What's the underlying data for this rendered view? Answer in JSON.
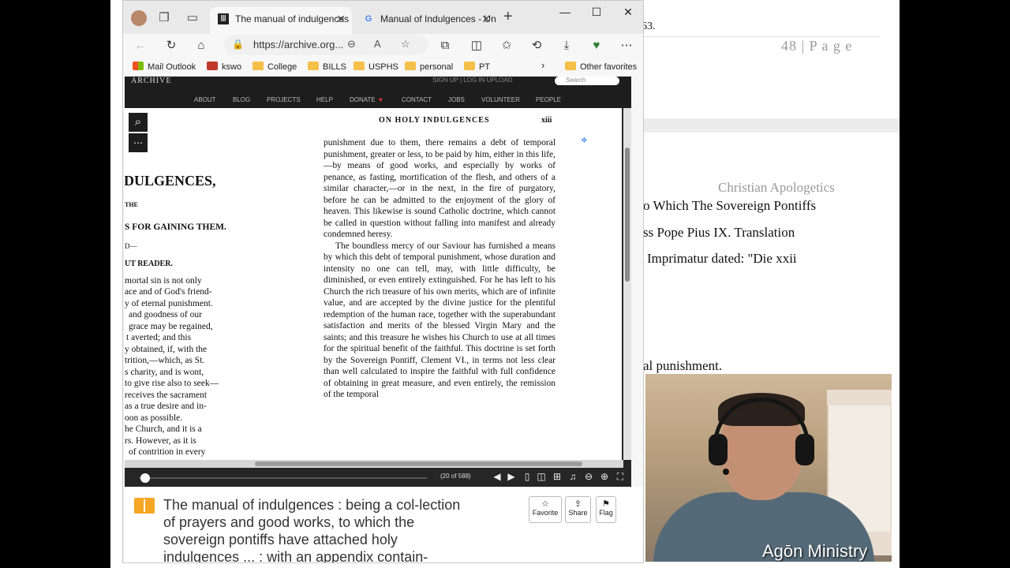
{
  "background_doc": {
    "top_fragment": "63.",
    "page_label": "48 | P a g e",
    "header_right": "Christian Apologetics",
    "lines": [
      "o Which The Sovereign Pontiffs",
      "ss Pope Pius IX. Translation",
      "Imprimatur dated: \"Die xxii",
      "al punishment."
    ]
  },
  "browser": {
    "tabs": [
      {
        "title": "The manual of indulgences",
        "active": true
      },
      {
        "title": "Manual of Indulgences - Un",
        "active": false
      }
    ],
    "address": "https://archive.org...",
    "bookmarks": [
      "Mail Outlook",
      "kswo",
      "College",
      "BILLS",
      "USPHS",
      "personal",
      "PT",
      "Other favorites"
    ]
  },
  "archive": {
    "logo": "ARCHIVE",
    "top_links": "SIGN UP | LOG IN    UPLOAD",
    "search_placeholder": "Search",
    "nav": [
      "ABOUT",
      "BLOG",
      "PROJECTS",
      "HELP",
      "DONATE",
      "CONTACT",
      "JOBS",
      "VOLUNTEER",
      "PEOPLE"
    ],
    "page_counter": "(20 of 588)",
    "book_title": "The manual of indulgences : being a col-lection of prayers and good works, to which the sovereign pontiffs have attached holy indulgences ... : with an appendix contain-",
    "actions": [
      "Favorite",
      "Share",
      "Flag"
    ]
  },
  "scan": {
    "left_lines": [
      "DULGENCES,",
      "THE",
      "S FOR GAINING THEM.",
      "D—",
      "UT READER.",
      "mortal sin is not only",
      "ace and of God's friend-",
      "y of eternal punishment.",
      "and goodness of our",
      "grace may be regained,",
      "t averted; and this",
      "y obtained, if, with the",
      "trition,—which, as St.",
      "s charity, and is wont,",
      "to give rise also to seek—",
      "receives the sacrament",
      "as a true desire and in-",
      "oon as possible.",
      "he Church, and it is a",
      "rs. However, as it is",
      "of contrition in every"
    ],
    "running_head": "ON HOLY INDULGENCES",
    "page_number": "xiii",
    "paragraphs": [
      "punishment due to them, there remains a debt of temporal punishment, greater or less, to be paid by him, either in this life,—by means of good works, and especially by works of penance, as fasting, mortification of the flesh, and others of a similar character,—or in the next, in the fire of purgatory, before he can be admitted to the enjoyment of the glory of heaven. This likewise is sound Catholic doctrine, which cannot be called in question without falling into manifest and already condemned heresy.",
      "The boundless mercy of our Saviour has furnished a means by which this debt of temporal punishment, whose duration and intensity no one can tell, may, with little difficulty, be diminished, or even entirely extinguished. For he has left to his Church the rich treasure of his own merits, which are of infinite value, and are accepted by the divine justice for the plentiful redemption of the human race, together with the superabundant satisfaction and merits of the blessed Virgin Mary and the saints; and this treasure he wishes his Church to use at all times for the spiritual benefit of the faithful. This doctrine is set forth by the Sovereign Pontiff, Clement VI., in terms not less clear than well calculated to inspire the faithful with full confidence of obtaining in great measure, and even entirely, the remission of the temporal"
    ]
  },
  "overlay": {
    "watermark": "Agōn Ministry"
  }
}
